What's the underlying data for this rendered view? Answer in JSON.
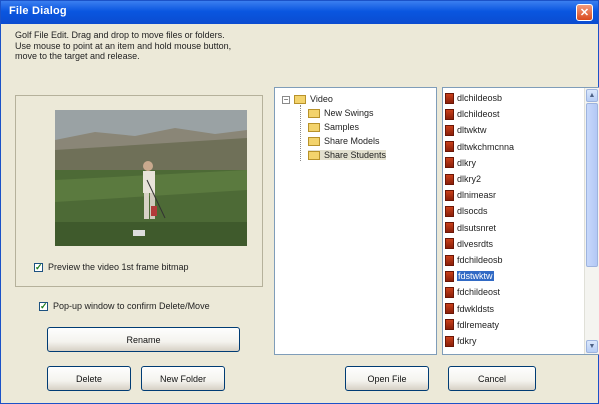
{
  "window": {
    "title": "File Dialog",
    "close_glyph": "✕"
  },
  "instructions": [
    "Golf File Edit. Drag and drop to move files or folders.",
    "Use mouse to point at an item and hold mouse button,",
    "move to the target and release."
  ],
  "preview": {
    "checkbox_label": "Preview the video 1st frame bitmap",
    "checked": true
  },
  "popup": {
    "checkbox_label": "Pop-up window to confirm Delete/Move",
    "checked": true
  },
  "buttons": {
    "rename": "Rename",
    "delete": "Delete",
    "new_folder": "New Folder",
    "open_file": "Open File",
    "cancel": "Cancel"
  },
  "tree": {
    "expander": "−",
    "root": "Video",
    "children": [
      "New Swings",
      "Samples",
      "Share Models",
      "Share Students"
    ],
    "selected_index": 3
  },
  "files": {
    "items": [
      "dlchildeosb",
      "dlchildeost",
      "dltwktw",
      "dltwkchmcnna",
      "dlkry",
      "dlkry2",
      "dlnimeasr",
      "dlsocds",
      "dlsutsnret",
      "dlvesrdts",
      "fdchildeosb",
      "fdstwktw",
      "fdchildeost",
      "fdwkldsts",
      "fdlremeaty",
      "fdkry"
    ],
    "selected_index": 11,
    "scroll_up": "▲",
    "scroll_down": "▼"
  },
  "colors": {
    "titlebar": "#0a56e0",
    "selection": "#316ac5",
    "window_bg": "#ece9d8"
  }
}
